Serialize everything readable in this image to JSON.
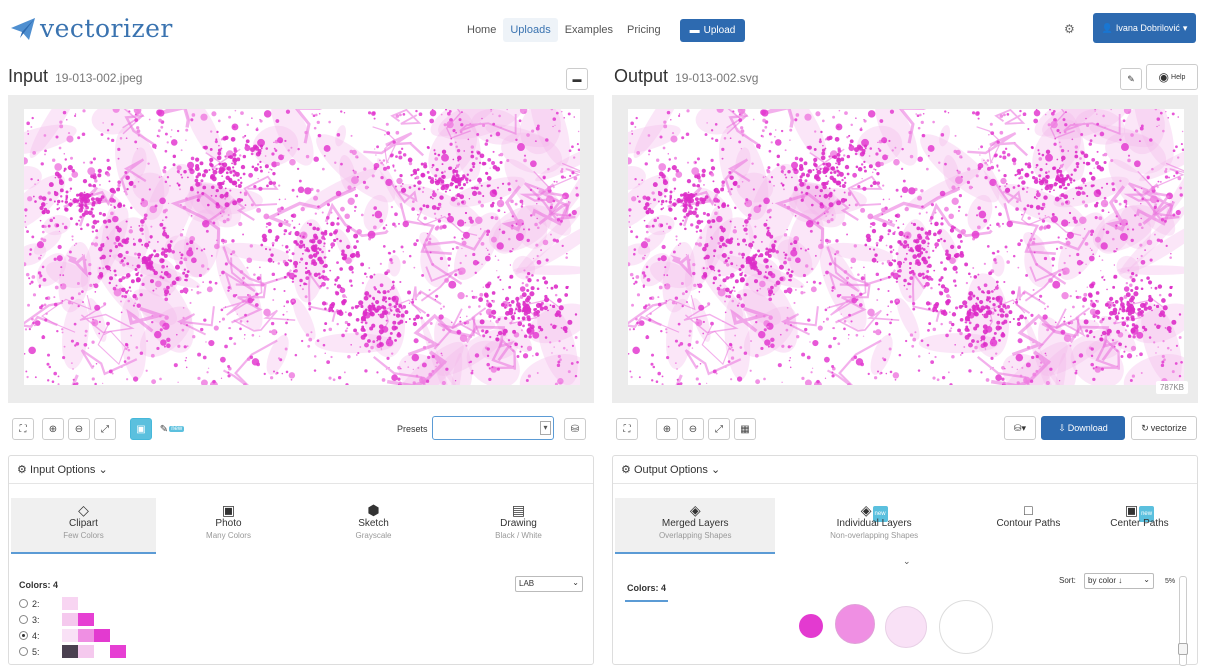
{
  "nav": {
    "logo_text": "vectorizer",
    "links": [
      "Home",
      "Uploads",
      "Examples",
      "Pricing"
    ],
    "upload_label": "Upload",
    "user_label": "Ivana Dobrilović"
  },
  "input": {
    "title": "Input",
    "filename": "19-013-002.jpeg",
    "presets_label": "Presets",
    "presets_value": "",
    "new_badge": "new",
    "options_label": "Input Options",
    "modes": [
      {
        "label": "Clipart",
        "sub": "Few Colors",
        "icon": "diamond-icon"
      },
      {
        "label": "Photo",
        "sub": "Many Colors",
        "icon": "photo-icon"
      },
      {
        "label": "Sketch",
        "sub": "Grayscale",
        "icon": "sketch-icon"
      },
      {
        "label": "Drawing",
        "sub": "Black / White",
        "icon": "drawing-icon"
      }
    ],
    "colors_label": "Colors: 4",
    "colorspace": "LAB",
    "color_options": [
      "2",
      "3",
      "4",
      "5"
    ],
    "selected_colors": "4"
  },
  "output": {
    "title": "Output",
    "filename": "19-013-002.svg",
    "help_label": "Help",
    "size": "787KB",
    "download_label": "Download",
    "vectorize_label": "vectorize",
    "options_label": "Output Options",
    "new_badge": "new",
    "modes": [
      {
        "label": "Merged Layers",
        "sub": "Overlapping Shapes",
        "icon": "layers-icon"
      },
      {
        "label": "Individual Layers",
        "sub": "Non-overlapping Shapes",
        "icon": "layers-icon"
      },
      {
        "label": "Contour Paths",
        "sub": "",
        "icon": "contour-icon"
      },
      {
        "label": "Center Paths",
        "sub": "",
        "icon": "center-icon"
      }
    ],
    "colors_label": "Colors: 4",
    "sort_label": "Sort:",
    "sort_value": "by color ↓",
    "pct_label": "5%",
    "swatches": [
      "#e33ad0",
      "#ef8fe3",
      "#f9e1f6",
      "#ffffff"
    ]
  },
  "colors": {
    "accent": "#2d6ab0",
    "magenta": "#e33ad0",
    "info": "#5bc0de"
  }
}
